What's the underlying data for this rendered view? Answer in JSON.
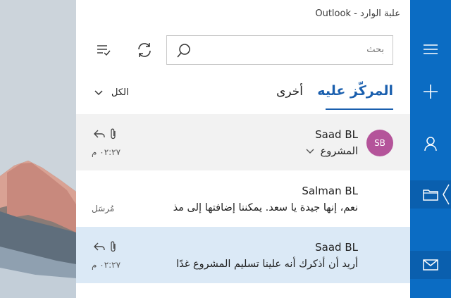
{
  "window": {
    "title": "علبة الوارد - Outlook"
  },
  "search": {
    "placeholder": "بحث",
    "icon": "search-icon"
  },
  "toolbar": {
    "select_icon": "checklist-icon",
    "sync_icon": "sync-icon"
  },
  "tabs": {
    "focused": "المركّز عليه",
    "other": "أخرى",
    "filter_label": "الكل"
  },
  "messages": [
    {
      "sender": "Saad BL",
      "line2": "المشروع",
      "time": "٠٢:٢٧ م",
      "avatar": "SB",
      "selected": false,
      "hovered": true,
      "icons": [
        "reply-icon",
        "attachment-icon"
      ]
    },
    {
      "sender": "Salman BL",
      "line2": "نعم، إنها جيدة يا سعد. يمكننا إضافتها إلى مذ",
      "time": "مُرسَل",
      "selected": false,
      "hovered": false,
      "icons": []
    },
    {
      "sender": "Saad BL",
      "line2": "أريد أن أذكرك أنه علينا تسليم المشروع غدًا",
      "time": "٠٢:٢٧ م",
      "selected": true,
      "hovered": false,
      "icons": [
        "reply-icon",
        "attachment-icon"
      ]
    }
  ],
  "rail": {
    "items": [
      "hamburger-icon",
      "plus-icon",
      "person-icon",
      "folder-icon",
      "mail-icon"
    ]
  },
  "colors": {
    "accent": "#1a5fae",
    "rail": "#0b6cc3",
    "selected_row": "#dbe9f6",
    "hover_row": "#f2f2f2",
    "avatar": "#b4549a"
  }
}
